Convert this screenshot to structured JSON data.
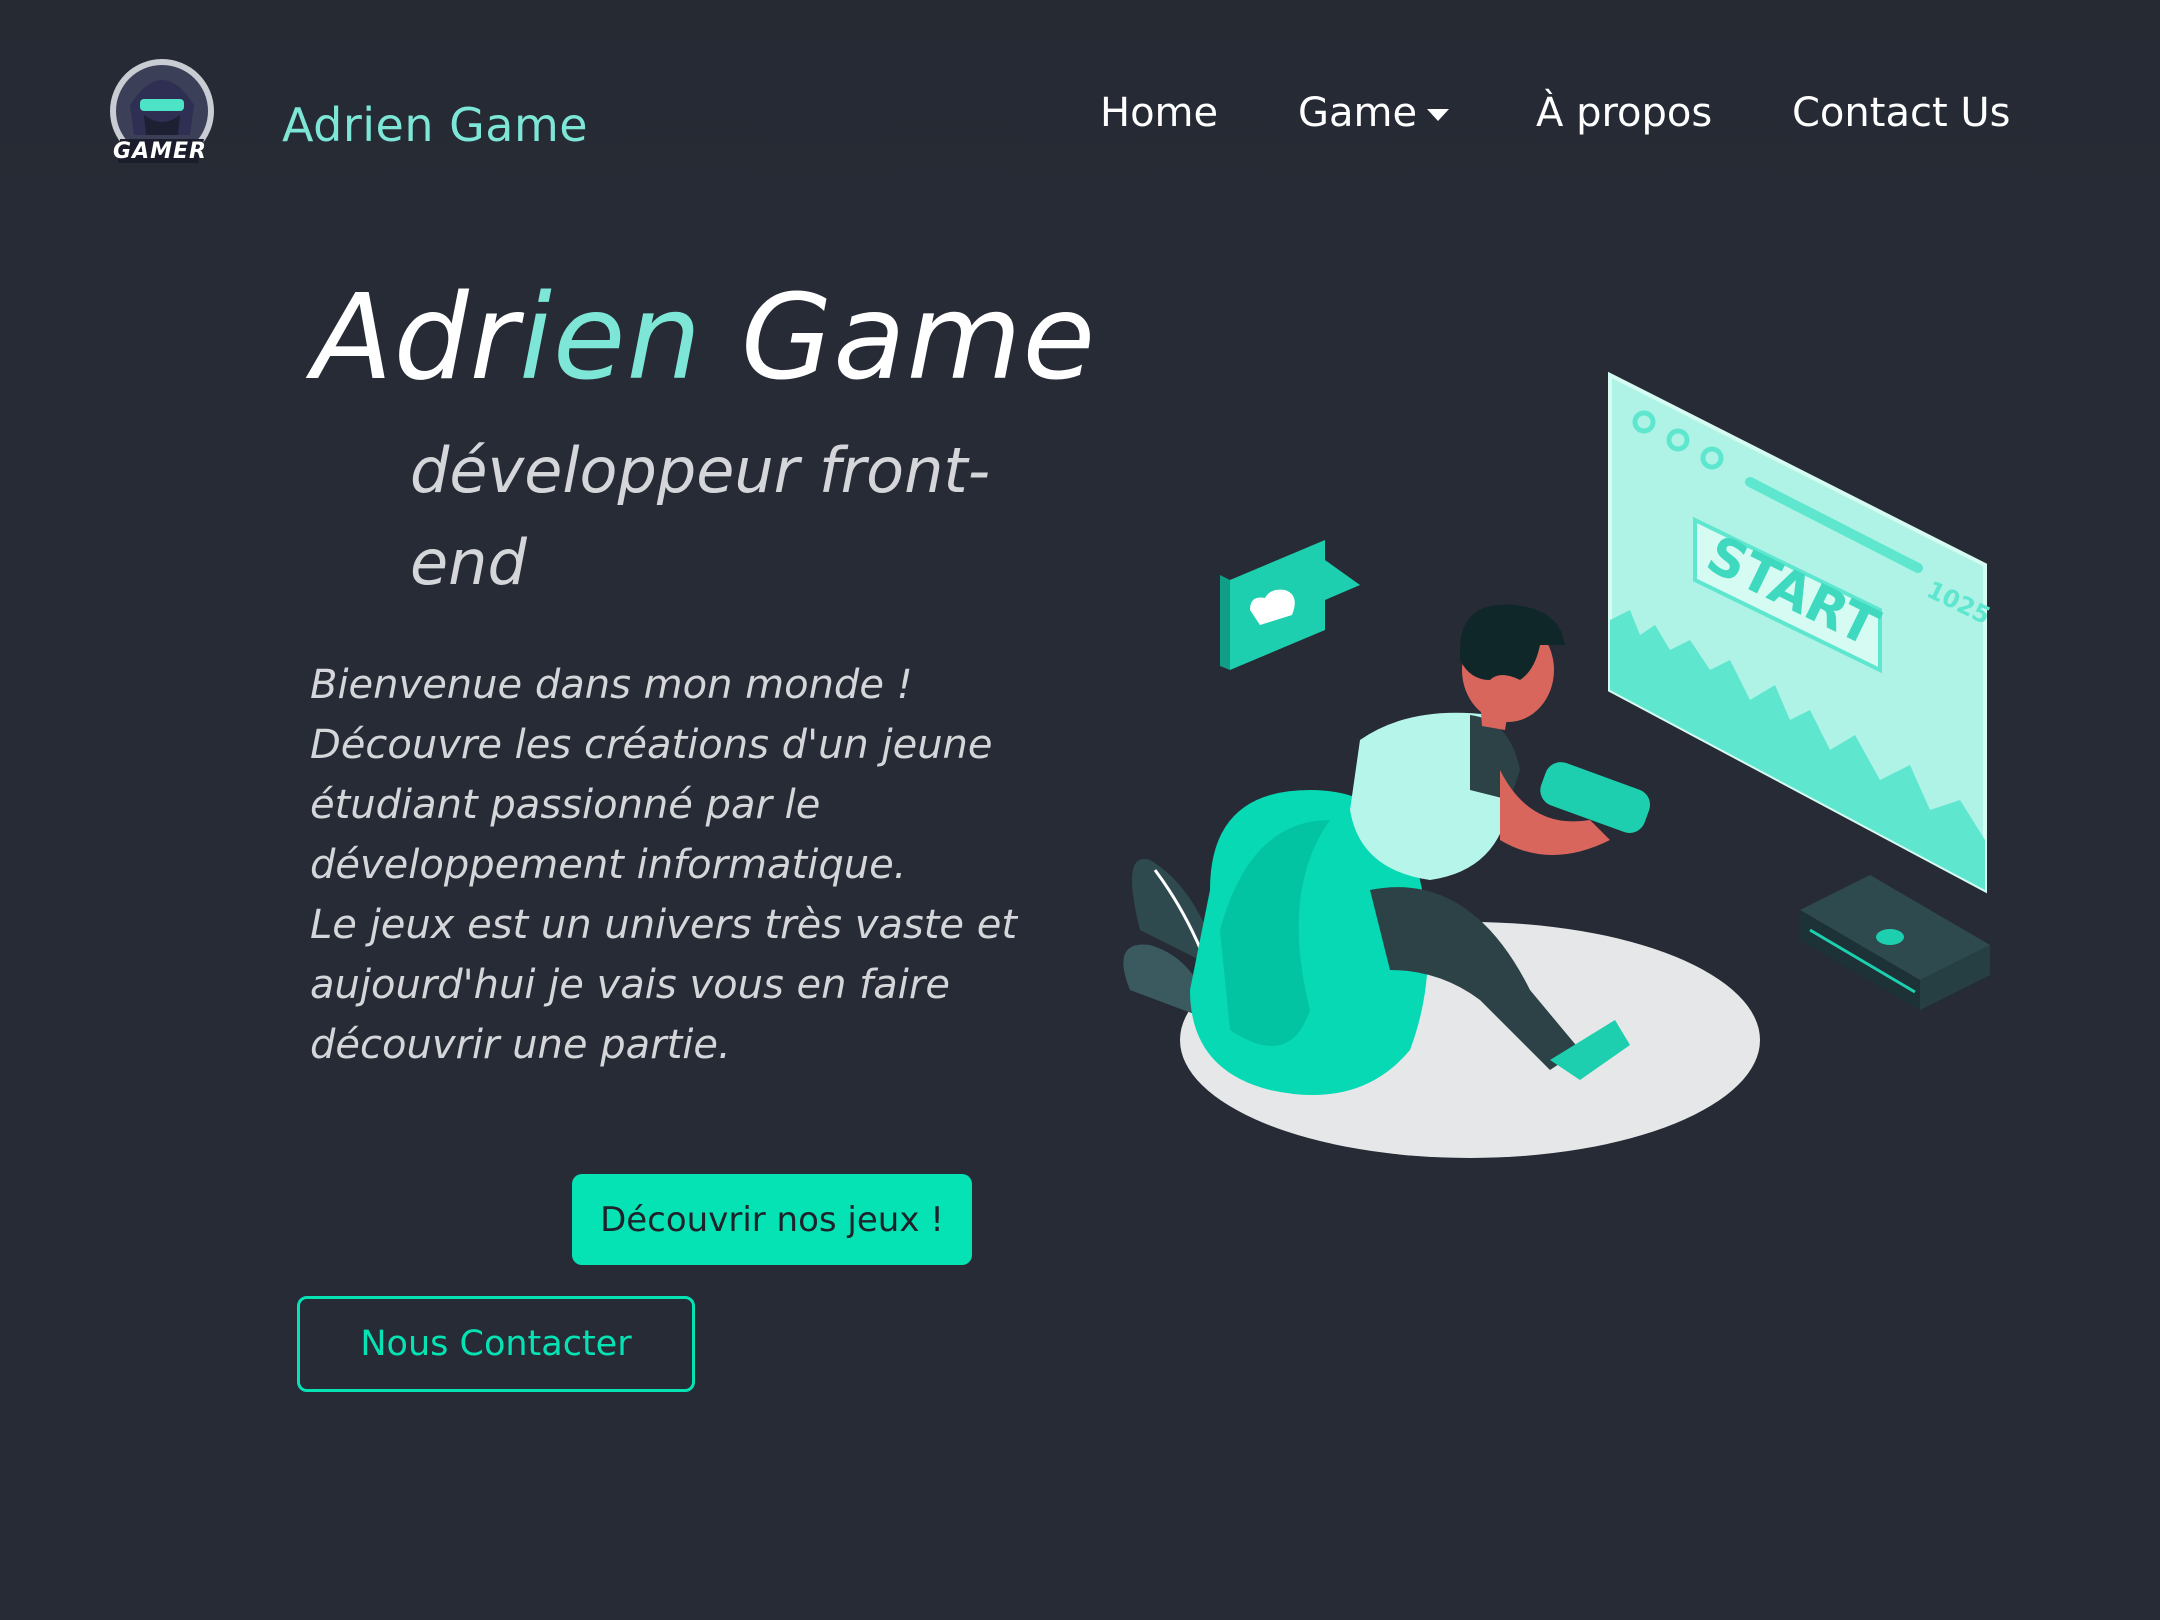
{
  "navbar": {
    "brand": "Adrien Game",
    "logo_icon": "gamer-mascot-logo",
    "logo_text": "GAMER",
    "links": [
      {
        "label": "Home"
      },
      {
        "label": "Game",
        "has_dropdown": true
      },
      {
        "label": "À propos"
      },
      {
        "label": "Contact Us"
      }
    ]
  },
  "hero": {
    "title_part1": "Adr",
    "title_accent": "ien",
    "title_part2": " Game",
    "subtitle": "développeur front-end",
    "description_lines": [
      "Bienvenue dans mon monde !",
      "Découvre les créations d'un jeune",
      "étudiant passionné par le",
      "développement informatique.",
      "Le jeux est un univers très vaste et",
      "aujourd'hui je vais vous en faire",
      "découvrir une partie."
    ],
    "primary_button": "Découvrir nos jeux !",
    "secondary_button": "Nous Contacter"
  },
  "illustration": {
    "icon": "gamer-playing-console-illustration",
    "screen_text": "START",
    "score": "1025"
  },
  "colors": {
    "background": "#262b35",
    "accent": "#7de6d6",
    "button": "#05e3b5",
    "text": "#ffffff",
    "muted_text": "#d4d6da"
  }
}
